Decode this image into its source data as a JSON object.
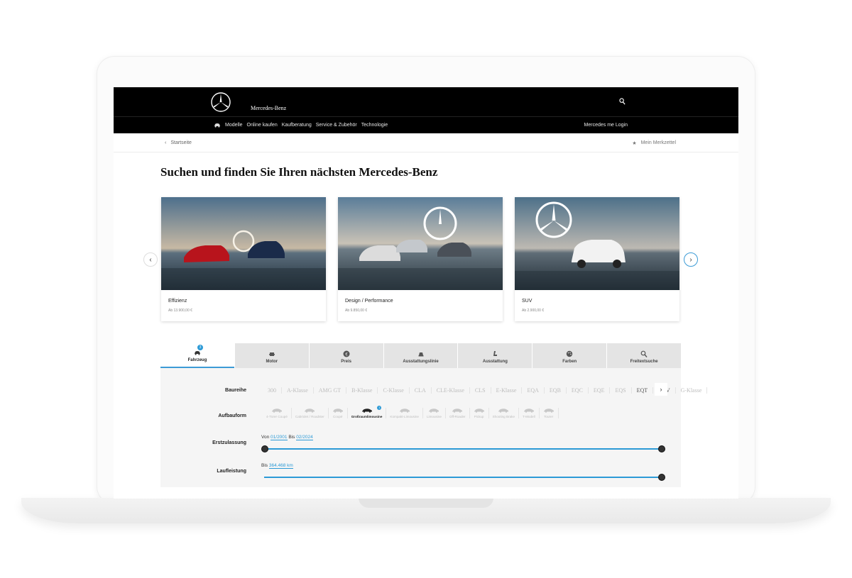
{
  "header": {
    "brand": "Mercedes-Benz",
    "nav": [
      "Modelle",
      "Online kaufen",
      "Kaufberatung",
      "Service & Zubehör",
      "Technologie"
    ],
    "login": "Mercedes me Login"
  },
  "breadcrumb": {
    "back": "Startseite",
    "wishlist": "Mein Merkzettel"
  },
  "title": "Suchen und finden Sie Ihren nächsten Mercedes-Benz",
  "cards": [
    {
      "title": "Effizienz",
      "price": "Ab 13.900,00 €"
    },
    {
      "title": "Design / Performance",
      "price": "Ab 9.850,00 €"
    },
    {
      "title": "SUV",
      "price": "Ab 2.900,00 €"
    }
  ],
  "tabs": [
    {
      "label": "Fahrzeug",
      "icon": "car-icon",
      "badge": "3"
    },
    {
      "label": "Motor",
      "icon": "engine-icon"
    },
    {
      "label": "Preis",
      "icon": "euro-icon"
    },
    {
      "label": "Ausstattungslinie",
      "icon": "car-front-icon"
    },
    {
      "label": "Ausstattung",
      "icon": "seat-icon"
    },
    {
      "label": "Farben",
      "icon": "palette-icon"
    },
    {
      "label": "Freitextsuche",
      "icon": "search-icon"
    }
  ],
  "filters": {
    "series_label": "Baureihe",
    "series": [
      "300",
      "A-Klasse",
      "AMG GT",
      "B-Klasse",
      "C-Klasse",
      "CLA",
      "CLE-Klasse",
      "CLS",
      "E-Klasse",
      "EQA",
      "EQB",
      "EQC",
      "EQE",
      "EQS",
      "EQT",
      "EQV",
      "G-Klasse"
    ],
    "series_active": [
      "EQT",
      "EQV"
    ],
    "body_label": "Aufbauform",
    "bodies": [
      "4-Türer Coupé",
      "Cabriolet / Roadster",
      "Coupé",
      "Großraumlimousine",
      "Kompakt-Limousine",
      "Limousine",
      "Off-Roader",
      "Pickup",
      "Shooting Brake",
      "T-Modell",
      "Tourer"
    ],
    "body_active": "Großraumlimousine",
    "body_badge": "1",
    "reg_label": "Erstzulassung",
    "reg_from_word": "Von",
    "reg_from": "01/2001",
    "reg_to_word": "Bis",
    "reg_to": "02/2024",
    "km_label": "Laufleistung",
    "km_to_word": "Bis",
    "km_to": "364.468 km"
  }
}
